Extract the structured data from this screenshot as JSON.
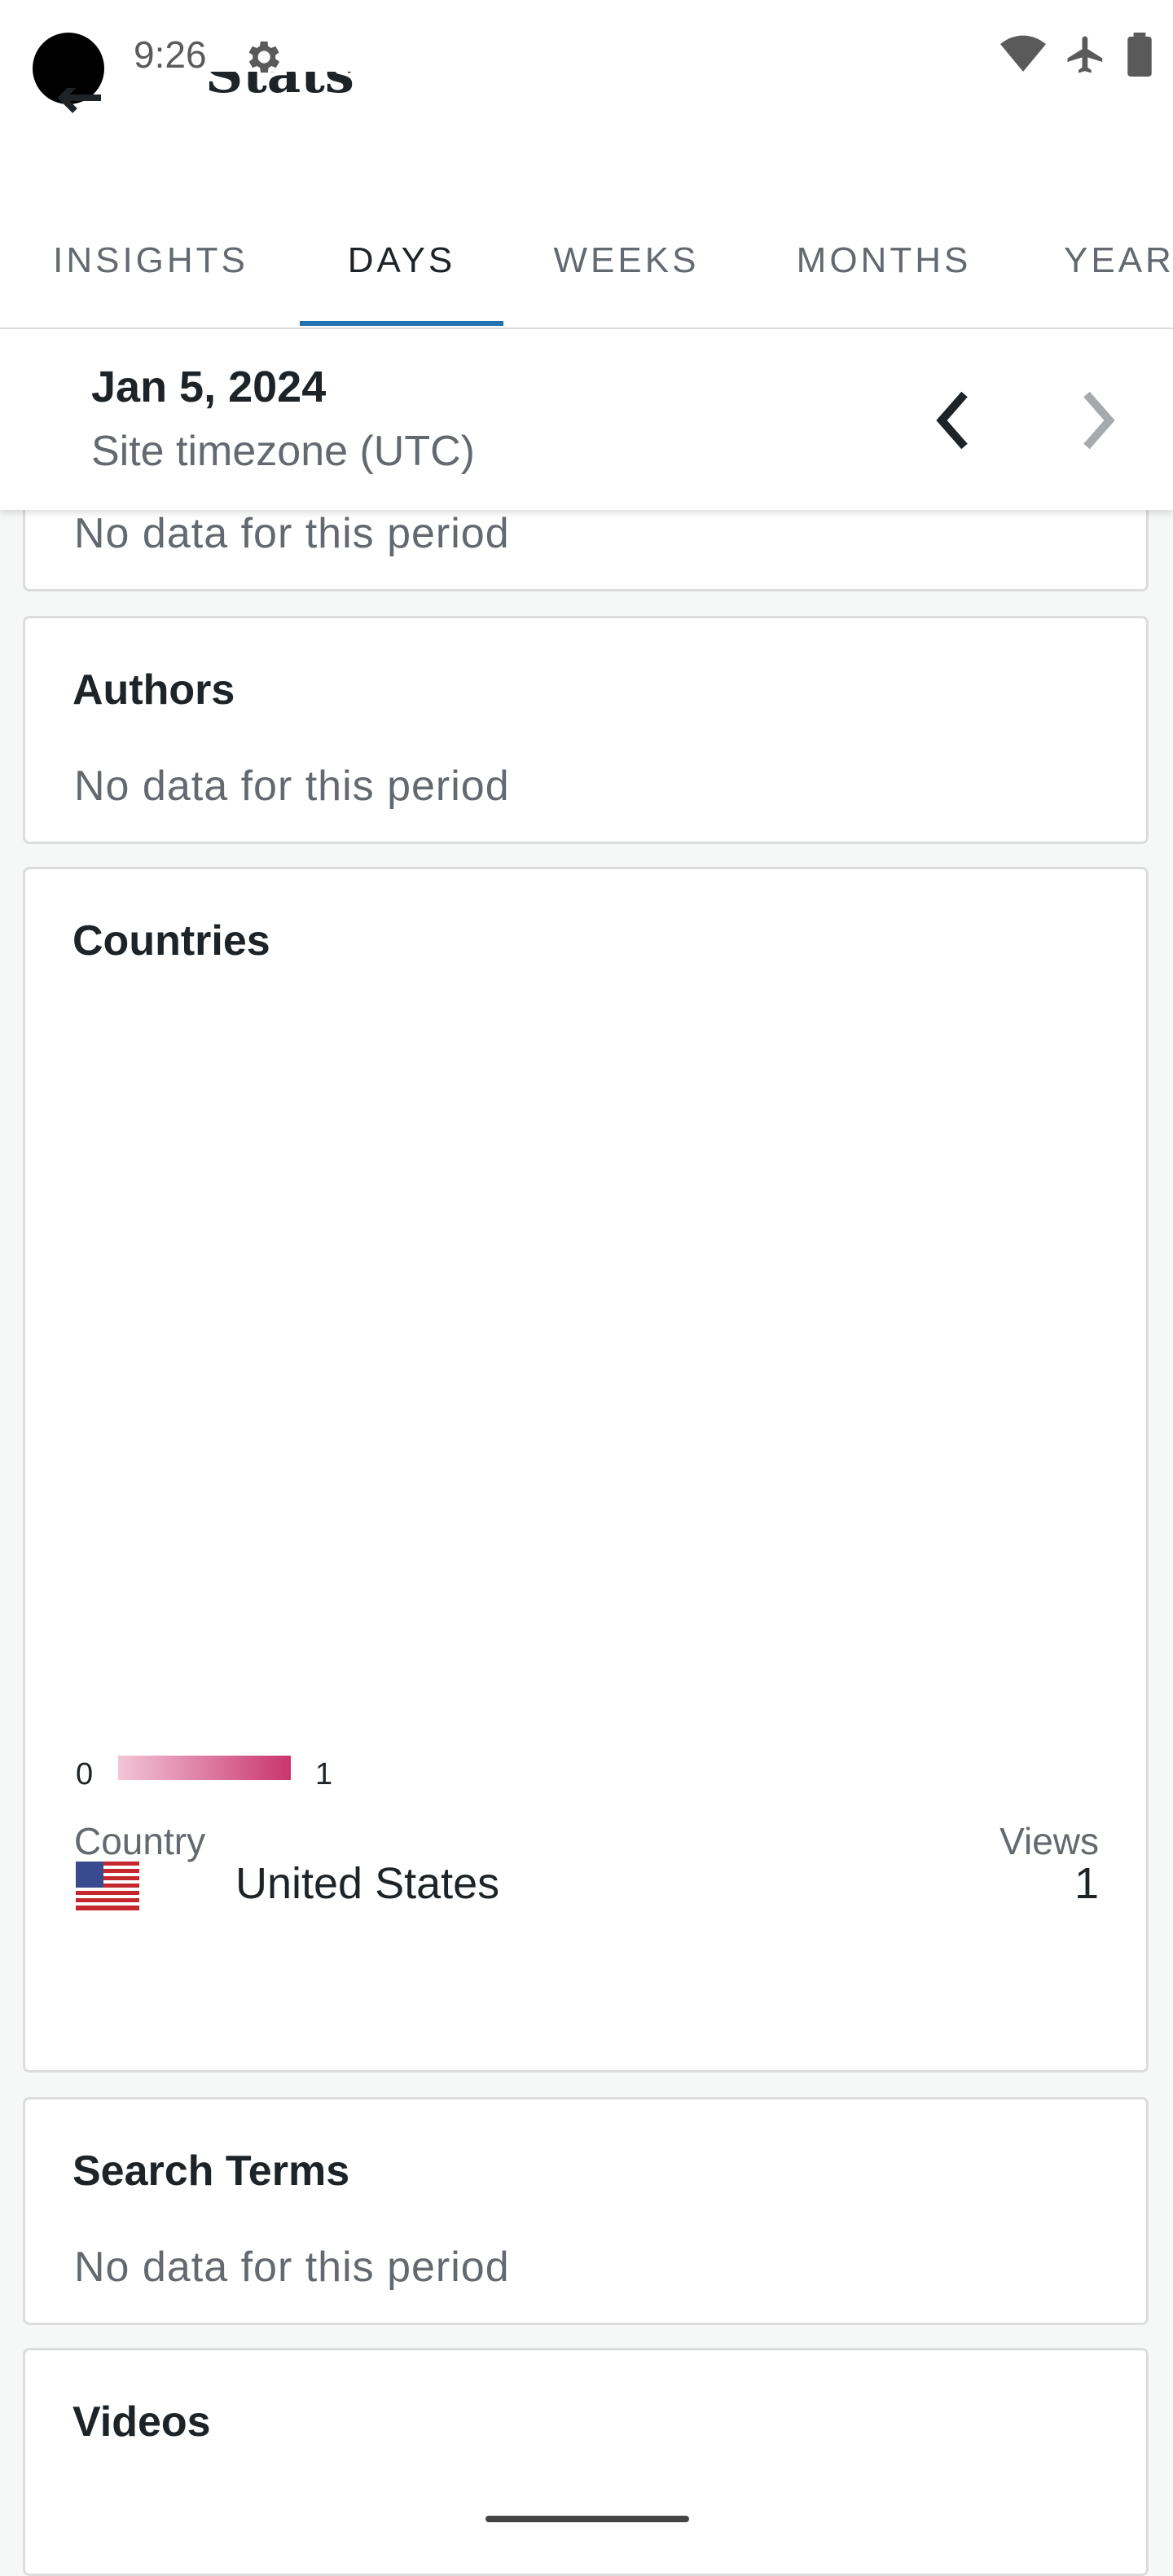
{
  "status_bar": {
    "time": "9:26",
    "icons": [
      "settings-icon",
      "wifi-icon",
      "airplane-mode-icon",
      "battery-icon"
    ]
  },
  "app_bar": {
    "title": "Stats",
    "back_icon": "back-arrow-icon"
  },
  "tabs": [
    {
      "label": "INSIGHTS",
      "active": false
    },
    {
      "label": "DAYS",
      "active": true
    },
    {
      "label": "WEEKS",
      "active": false
    },
    {
      "label": "MONTHS",
      "active": false
    },
    {
      "label": "YEARS",
      "active": false
    }
  ],
  "date_bar": {
    "date": "Jan 5, 2024",
    "timezone": "Site timezone (UTC)",
    "prev_icon": "chevron-left-icon",
    "next_icon": "chevron-right-icon"
  },
  "cards": {
    "previous_empty": "No data for this period",
    "authors": {
      "title": "Authors",
      "empty": "No data for this period"
    },
    "countries": {
      "title": "Countries",
      "legend_min": "0",
      "legend_max": "1",
      "col_country": "Country",
      "col_views": "Views",
      "rows": [
        {
          "country": "United States",
          "views": "1",
          "flag_icon": "us-flag-icon"
        }
      ]
    },
    "search_terms": {
      "title": "Search Terms",
      "empty": "No data for this period"
    },
    "videos": {
      "title": "Videos"
    }
  },
  "colors": {
    "accent": "#2271b1",
    "map_gradient_low": "#f2c6d6",
    "map_gradient_high": "#c9356e"
  }
}
